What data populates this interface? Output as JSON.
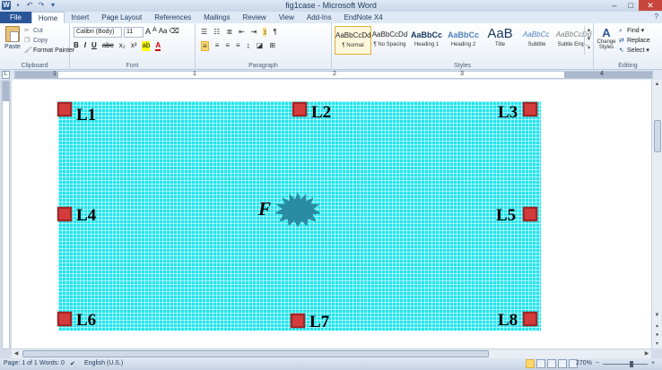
{
  "window": {
    "title": "fig1case - Microsoft Word",
    "app_icon": "W",
    "controls": [
      "–",
      "□",
      "✕"
    ]
  },
  "tabs": [
    {
      "label": "File"
    },
    {
      "label": "Home"
    },
    {
      "label": "Insert"
    },
    {
      "label": "Page Layout"
    },
    {
      "label": "References"
    },
    {
      "label": "Mailings"
    },
    {
      "label": "Review"
    },
    {
      "label": "View"
    },
    {
      "label": "Add-Ins"
    },
    {
      "label": "EndNote X4"
    }
  ],
  "ribbon": {
    "clipboard": {
      "group_label": "Clipboard",
      "paste": "Paste",
      "cut": "Cut",
      "copy": "Copy",
      "format_painter": "Format Painter"
    },
    "font": {
      "group_label": "Font",
      "font_name": "Calibri (Body)",
      "font_size": "11",
      "grow": "A",
      "shrink": "A",
      "case": "Aa",
      "bold": "B",
      "italic": "I",
      "underline": "U",
      "strike": "abc",
      "subscript": "x₂",
      "superscript": "x²",
      "highlight": "ab",
      "font_color": "A"
    },
    "paragraph": {
      "group_label": "Paragraph"
    },
    "styles": {
      "group_label": "Styles",
      "items": [
        {
          "preview": "AaBbCcDd",
          "name": "¶ Normal"
        },
        {
          "preview": "AaBbCcDd",
          "name": "¶ No Spacing"
        },
        {
          "preview": "AaBbCc",
          "name": "Heading 1"
        },
        {
          "preview": "AaBbCc",
          "name": "Heading 2"
        },
        {
          "preview": "AaB",
          "name": "Title"
        },
        {
          "preview": "AaBbCc ",
          "name": "Subtitle"
        },
        {
          "preview": "AaBbCcDd",
          "name": "Subtle Emp..."
        }
      ],
      "change_styles": "Change Styles"
    },
    "editing": {
      "group_label": "Editing",
      "find": "Find",
      "replace": "Replace",
      "select": "Select"
    }
  },
  "ruler": {
    "numbers": [
      "1",
      "1",
      "2",
      "3",
      "4"
    ]
  },
  "figure": {
    "background_color": "#22e4ee",
    "marker_color": "#d43b3b",
    "labels": [
      "L1",
      "L2",
      "L3",
      "L4",
      "L5",
      "L6",
      "L7",
      "L8"
    ],
    "source_label": "F"
  },
  "statusbar": {
    "page": "Page: 1 of 1",
    "words": "Words: 0",
    "language": "English (U.S.)",
    "zoom": "270%"
  }
}
